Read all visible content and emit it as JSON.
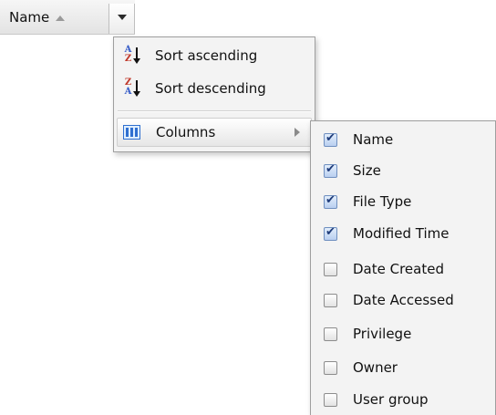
{
  "header": {
    "column_title": "Name"
  },
  "menu": {
    "items": [
      {
        "label": "Sort ascending",
        "icon": "sort-ascending-icon",
        "top_letter": "A",
        "bottom_letter": "Z"
      },
      {
        "label": "Sort descending",
        "icon": "sort-descending-icon",
        "top_letter": "Z",
        "bottom_letter": "A"
      }
    ],
    "columns_label": "Columns",
    "columns_icon": "columns-icon"
  },
  "columns": [
    {
      "label": "Name",
      "checked": true
    },
    {
      "label": "Size",
      "checked": true
    },
    {
      "label": "File Type",
      "checked": true
    },
    {
      "label": "Modified Time",
      "checked": true
    },
    {
      "label": "Date Created",
      "checked": false
    },
    {
      "label": "Date Accessed",
      "checked": false
    },
    {
      "label": "Privilege",
      "checked": false
    },
    {
      "label": "Owner",
      "checked": false
    },
    {
      "label": "User group",
      "checked": false
    }
  ],
  "colors": {
    "check_blue": "#1f3c7a",
    "icon_blue": "#2f6fd0",
    "sort_letter_blue": "#3a5fc8",
    "sort_letter_red": "#c0392b"
  }
}
